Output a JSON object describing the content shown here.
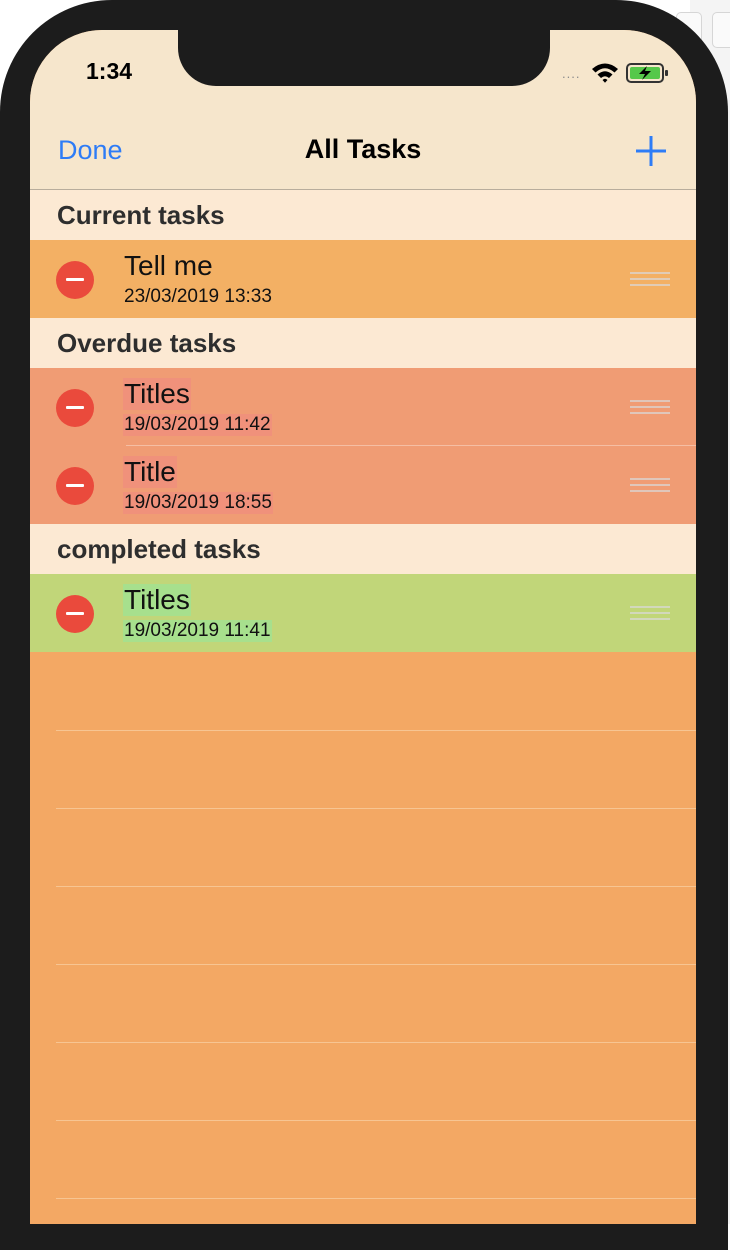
{
  "status_bar": {
    "time": "1:34",
    "signal": "....",
    "icons": [
      "wifi-icon",
      "battery-charging-icon"
    ]
  },
  "nav": {
    "done_label": "Done",
    "title": "All Tasks",
    "add_icon": "plus-icon"
  },
  "sections": [
    {
      "header": "Current tasks",
      "tasks": [
        {
          "title": "Tell me",
          "date": "23/03/2019 13:33"
        }
      ]
    },
    {
      "header": "Overdue tasks",
      "tasks": [
        {
          "title": "Titles",
          "date": "19/03/2019 11:42"
        },
        {
          "title": "Title",
          "date": "19/03/2019 18:55"
        }
      ]
    },
    {
      "header": "completed tasks",
      "tasks": [
        {
          "title": "Titles",
          "date": "19/03/2019 11:41"
        }
      ]
    }
  ],
  "colors": {
    "accent": "#2e7cf6",
    "bar_background": "#f6e6cc",
    "section_header_background": "#fce9d3",
    "current_row": "#f3b064",
    "overdue_row": "#f09c74",
    "completed_row": "#c1d679",
    "list_background": "#f3b064",
    "delete": "#ea4a3c",
    "overdue_text_highlight": "#f0917b",
    "completed_text_highlight": "#a7e08d"
  }
}
